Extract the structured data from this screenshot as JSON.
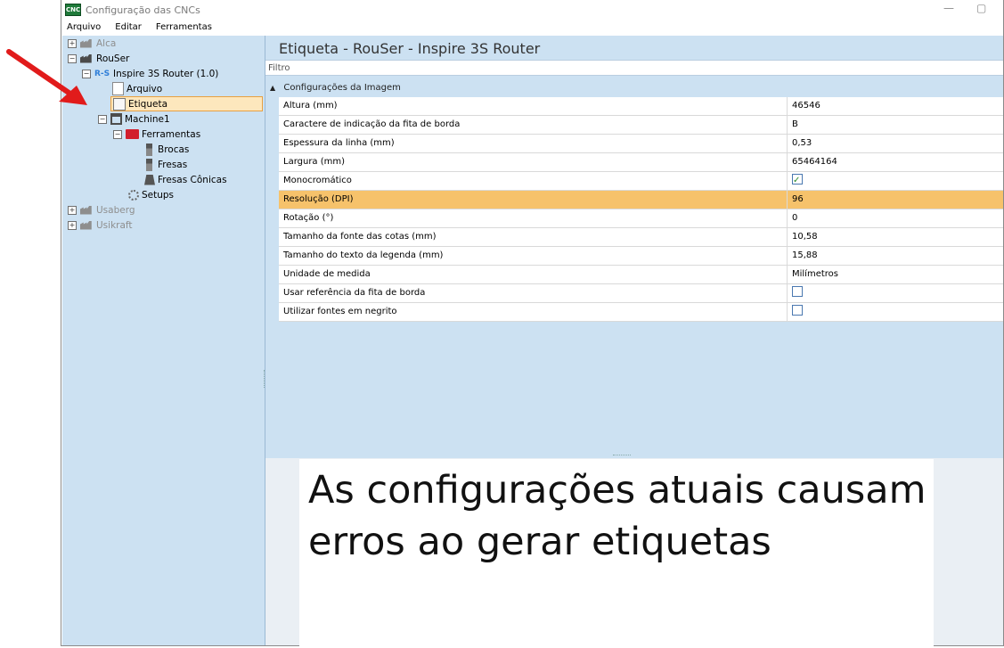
{
  "window": {
    "title": "Configuração das CNCs",
    "app_icon_text": "CNC",
    "menu": [
      "Arquivo",
      "Editar",
      "Ferramentas"
    ]
  },
  "tree": [
    {
      "label": "Alca",
      "icon": "factory-icon",
      "expander": "+",
      "greyed": true
    },
    {
      "label": "RouSer",
      "icon": "factory-icon",
      "expander": "-"
    },
    {
      "label": "Inspire 3S Router (1.0)",
      "icon": "router-icon",
      "icon_text": "R-S",
      "expander": "-"
    },
    {
      "label": "Arquivo",
      "icon": "document-icon"
    },
    {
      "label": "Etiqueta",
      "icon": "label-icon",
      "selected": true
    },
    {
      "label": "Machine1",
      "icon": "machine-icon",
      "expander": "-"
    },
    {
      "label": "Ferramentas",
      "icon": "toolbox-icon",
      "expander": "-"
    },
    {
      "label": "Brocas",
      "icon": "drill-icon"
    },
    {
      "label": "Fresas",
      "icon": "drill-icon"
    },
    {
      "label": "Fresas Cônicas",
      "icon": "cone-icon"
    },
    {
      "label": "Setups",
      "icon": "gear-icon"
    },
    {
      "label": "Usaberg",
      "icon": "factory-icon",
      "expander": "+",
      "greyed": true
    },
    {
      "label": "Usikraft",
      "icon": "factory-icon",
      "expander": "+",
      "greyed": true
    }
  ],
  "panel": {
    "title": "Etiqueta - RouSer - Inspire 3S Router",
    "filter_label": "Filtro",
    "category": "Configurações da Imagem",
    "properties": [
      {
        "name": "Altura (mm)",
        "value": "46546"
      },
      {
        "name": "Caractere de indicação da fita de borda",
        "value": "B"
      },
      {
        "name": "Espessura da linha (mm)",
        "value": "0,53"
      },
      {
        "name": "Largura (mm)",
        "value": "65464164"
      },
      {
        "name": "Monocromático",
        "checked": true
      },
      {
        "name": "Resolução (DPI)",
        "value": "96",
        "highlighted": true
      },
      {
        "name": "Rotação (°)",
        "value": "0"
      },
      {
        "name": "Tamanho da fonte das cotas (mm)",
        "value": "10,58"
      },
      {
        "name": "Tamanho do texto da legenda (mm)",
        "value": "15,88"
      },
      {
        "name": "Unidade de medida",
        "value": "Milímetros"
      },
      {
        "name": "Usar referência da fita de borda",
        "checked": false
      },
      {
        "name": "Utilizar fontes em negrito",
        "checked": false
      }
    ]
  },
  "callout": {
    "text": "As configurações atuais causam erros ao gerar etiquetas"
  },
  "colors": {
    "panel_bg": "#cce1f2",
    "highlight": "#f6c26b",
    "arrow": "#e11b1b"
  }
}
